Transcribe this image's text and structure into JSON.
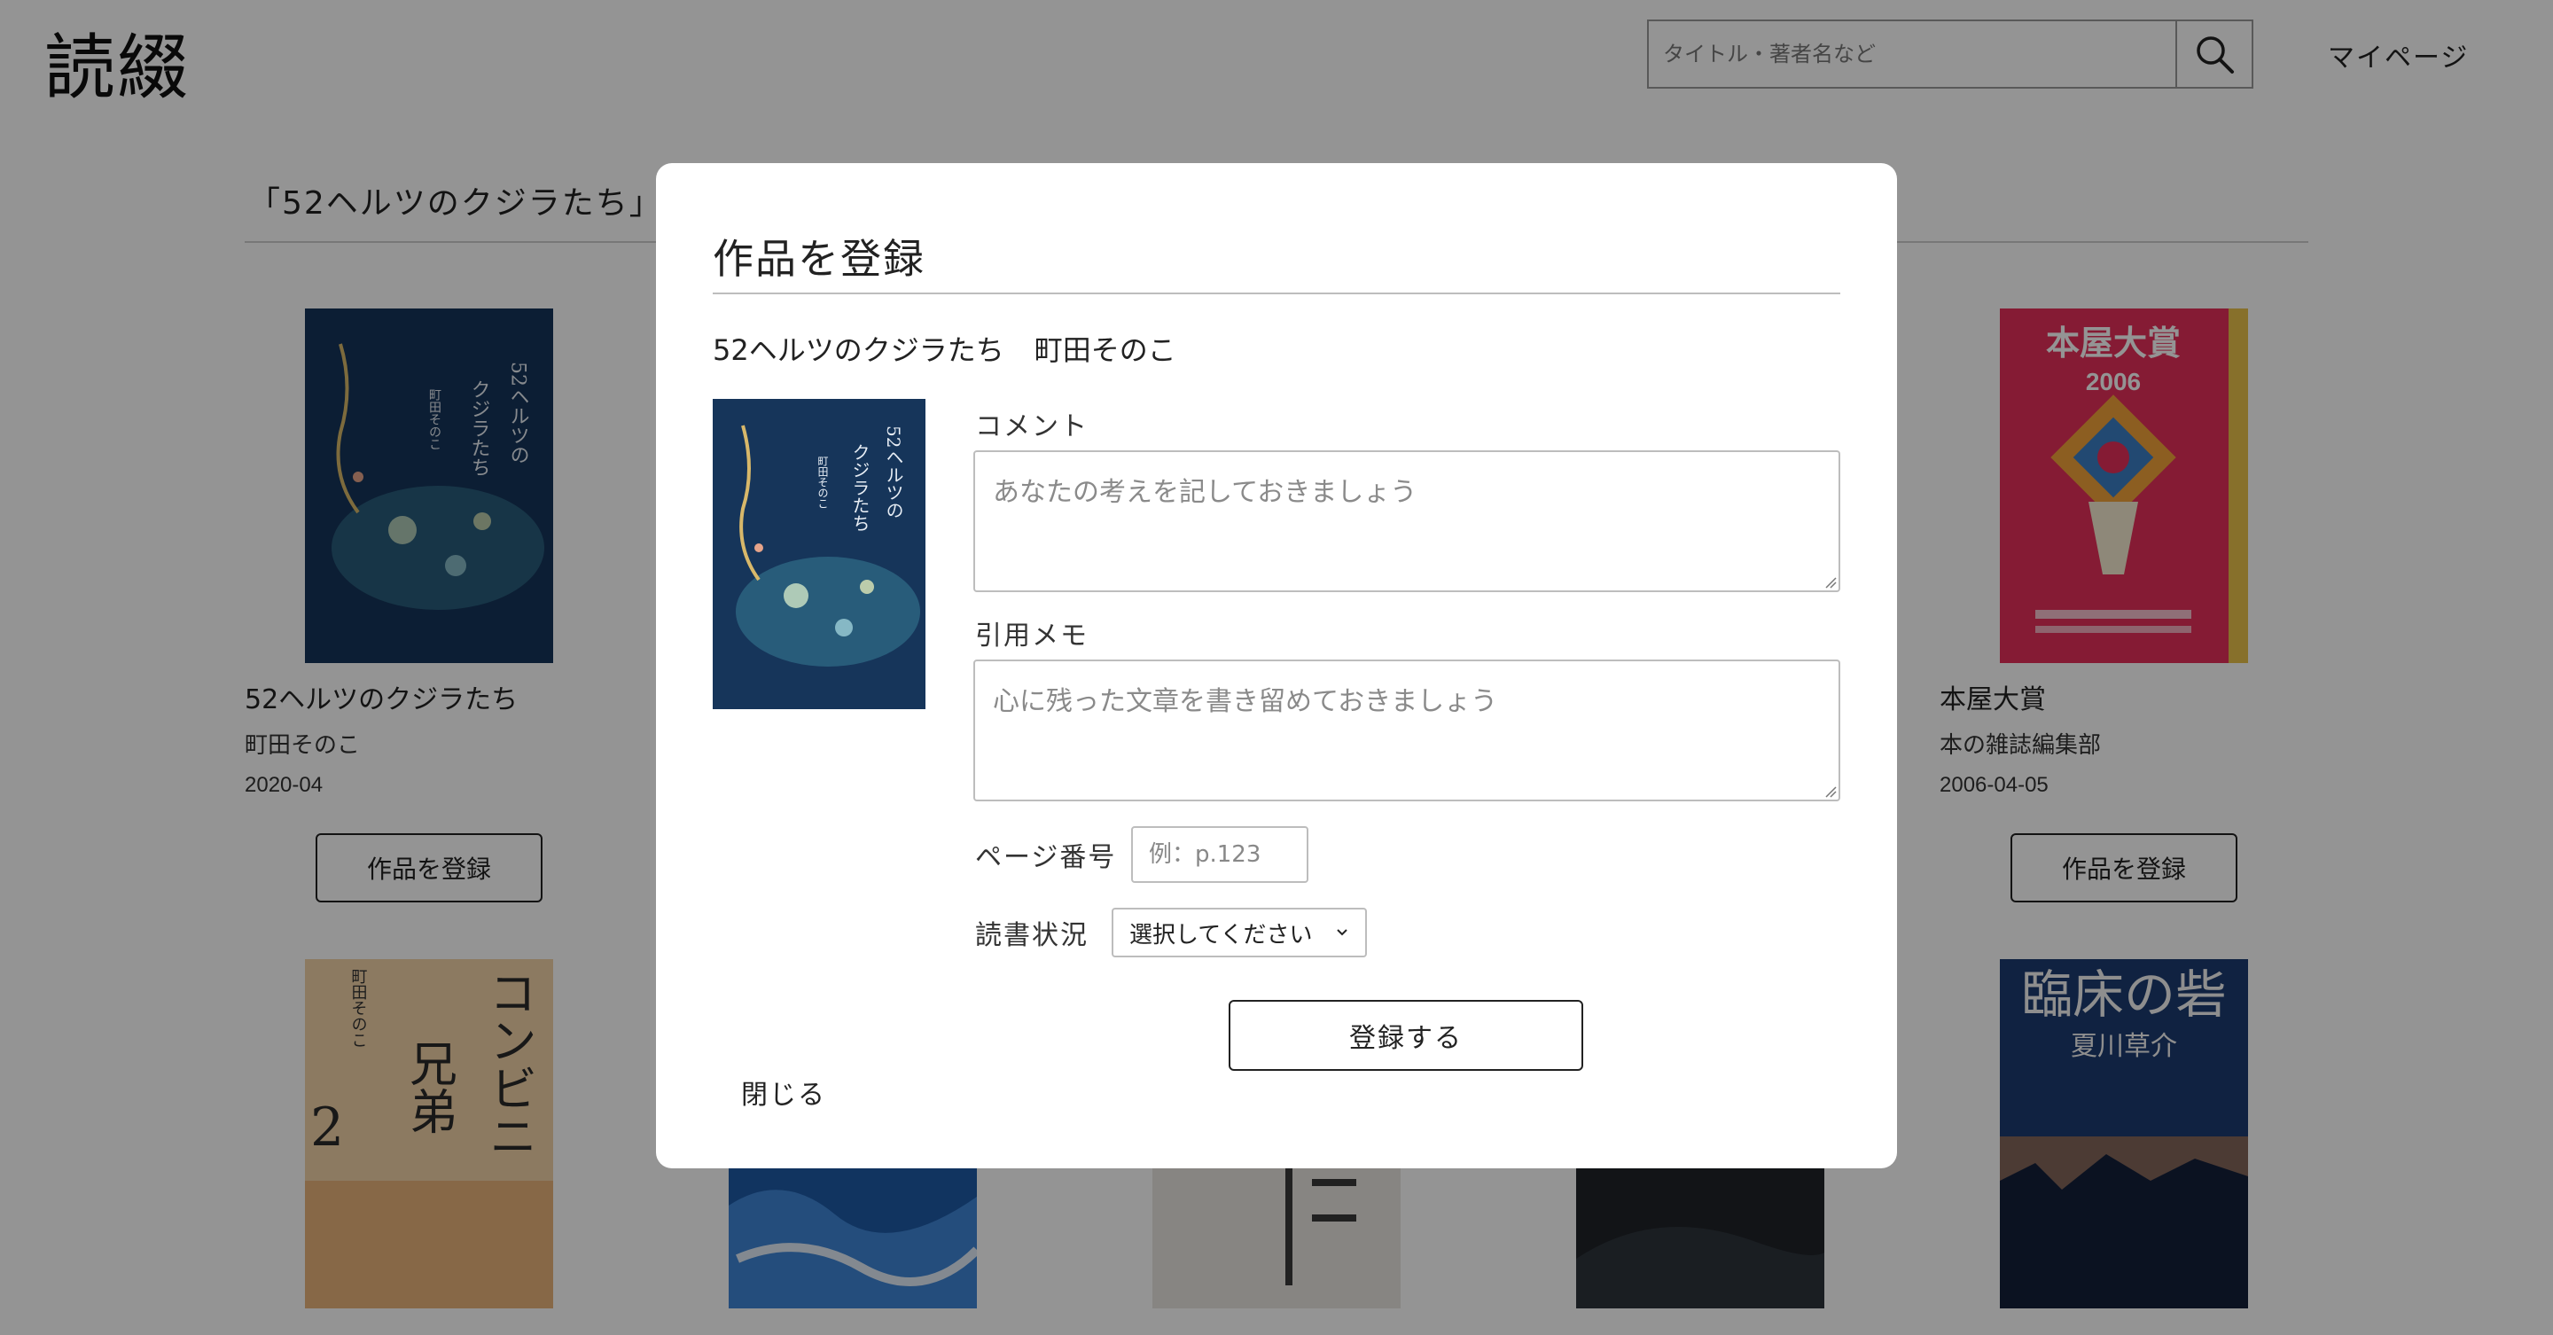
{
  "header": {
    "logo": "読綴",
    "search": {
      "placeholder": "タイトル・著者名など"
    },
    "mypage_label": "マイページ"
  },
  "results": {
    "heading": "「52ヘルツのクジラたち」"
  },
  "books": [
    {
      "title": "52ヘルツのクジラたち",
      "author": "町田そのこ",
      "date": "2020-04",
      "register_label": "作品を登録",
      "cover_text": "52ヘルツのクジラたち 町田そのこ"
    },
    {
      "title": "本屋大賞",
      "author": "本の雑誌編集部",
      "date": "2006-04-05",
      "register_label": "作品を登録",
      "cover_text": "本屋大賞 2006"
    }
  ],
  "second_row_covers": [
    {
      "cover_text": "コンビニ兄弟2 町田そのこ"
    },
    {
      "cover_text": ""
    },
    {
      "cover_text": ""
    },
    {
      "cover_text": ""
    },
    {
      "cover_text": "臨床の砦 夏川草介"
    }
  ],
  "modal": {
    "title": "作品を登録",
    "book_title": "52ヘルツのクジラたち",
    "book_author": "町田そのこ",
    "comment_label": "コメント",
    "comment_placeholder": "あなたの考えを記しておきましょう",
    "quote_label": "引用メモ",
    "quote_placeholder": "心に残った文章を書き留めておきましょう",
    "page_label": "ページ番号",
    "page_placeholder": "例：p.123",
    "status_label": "読書状況",
    "status_selected": "選択してください",
    "submit_label": "登録する",
    "close_label": "閉じる"
  },
  "colors": {
    "overlay": "#000000",
    "whale_cover_bg": "#16355a",
    "honya_cover_bg": "#e5305a"
  }
}
